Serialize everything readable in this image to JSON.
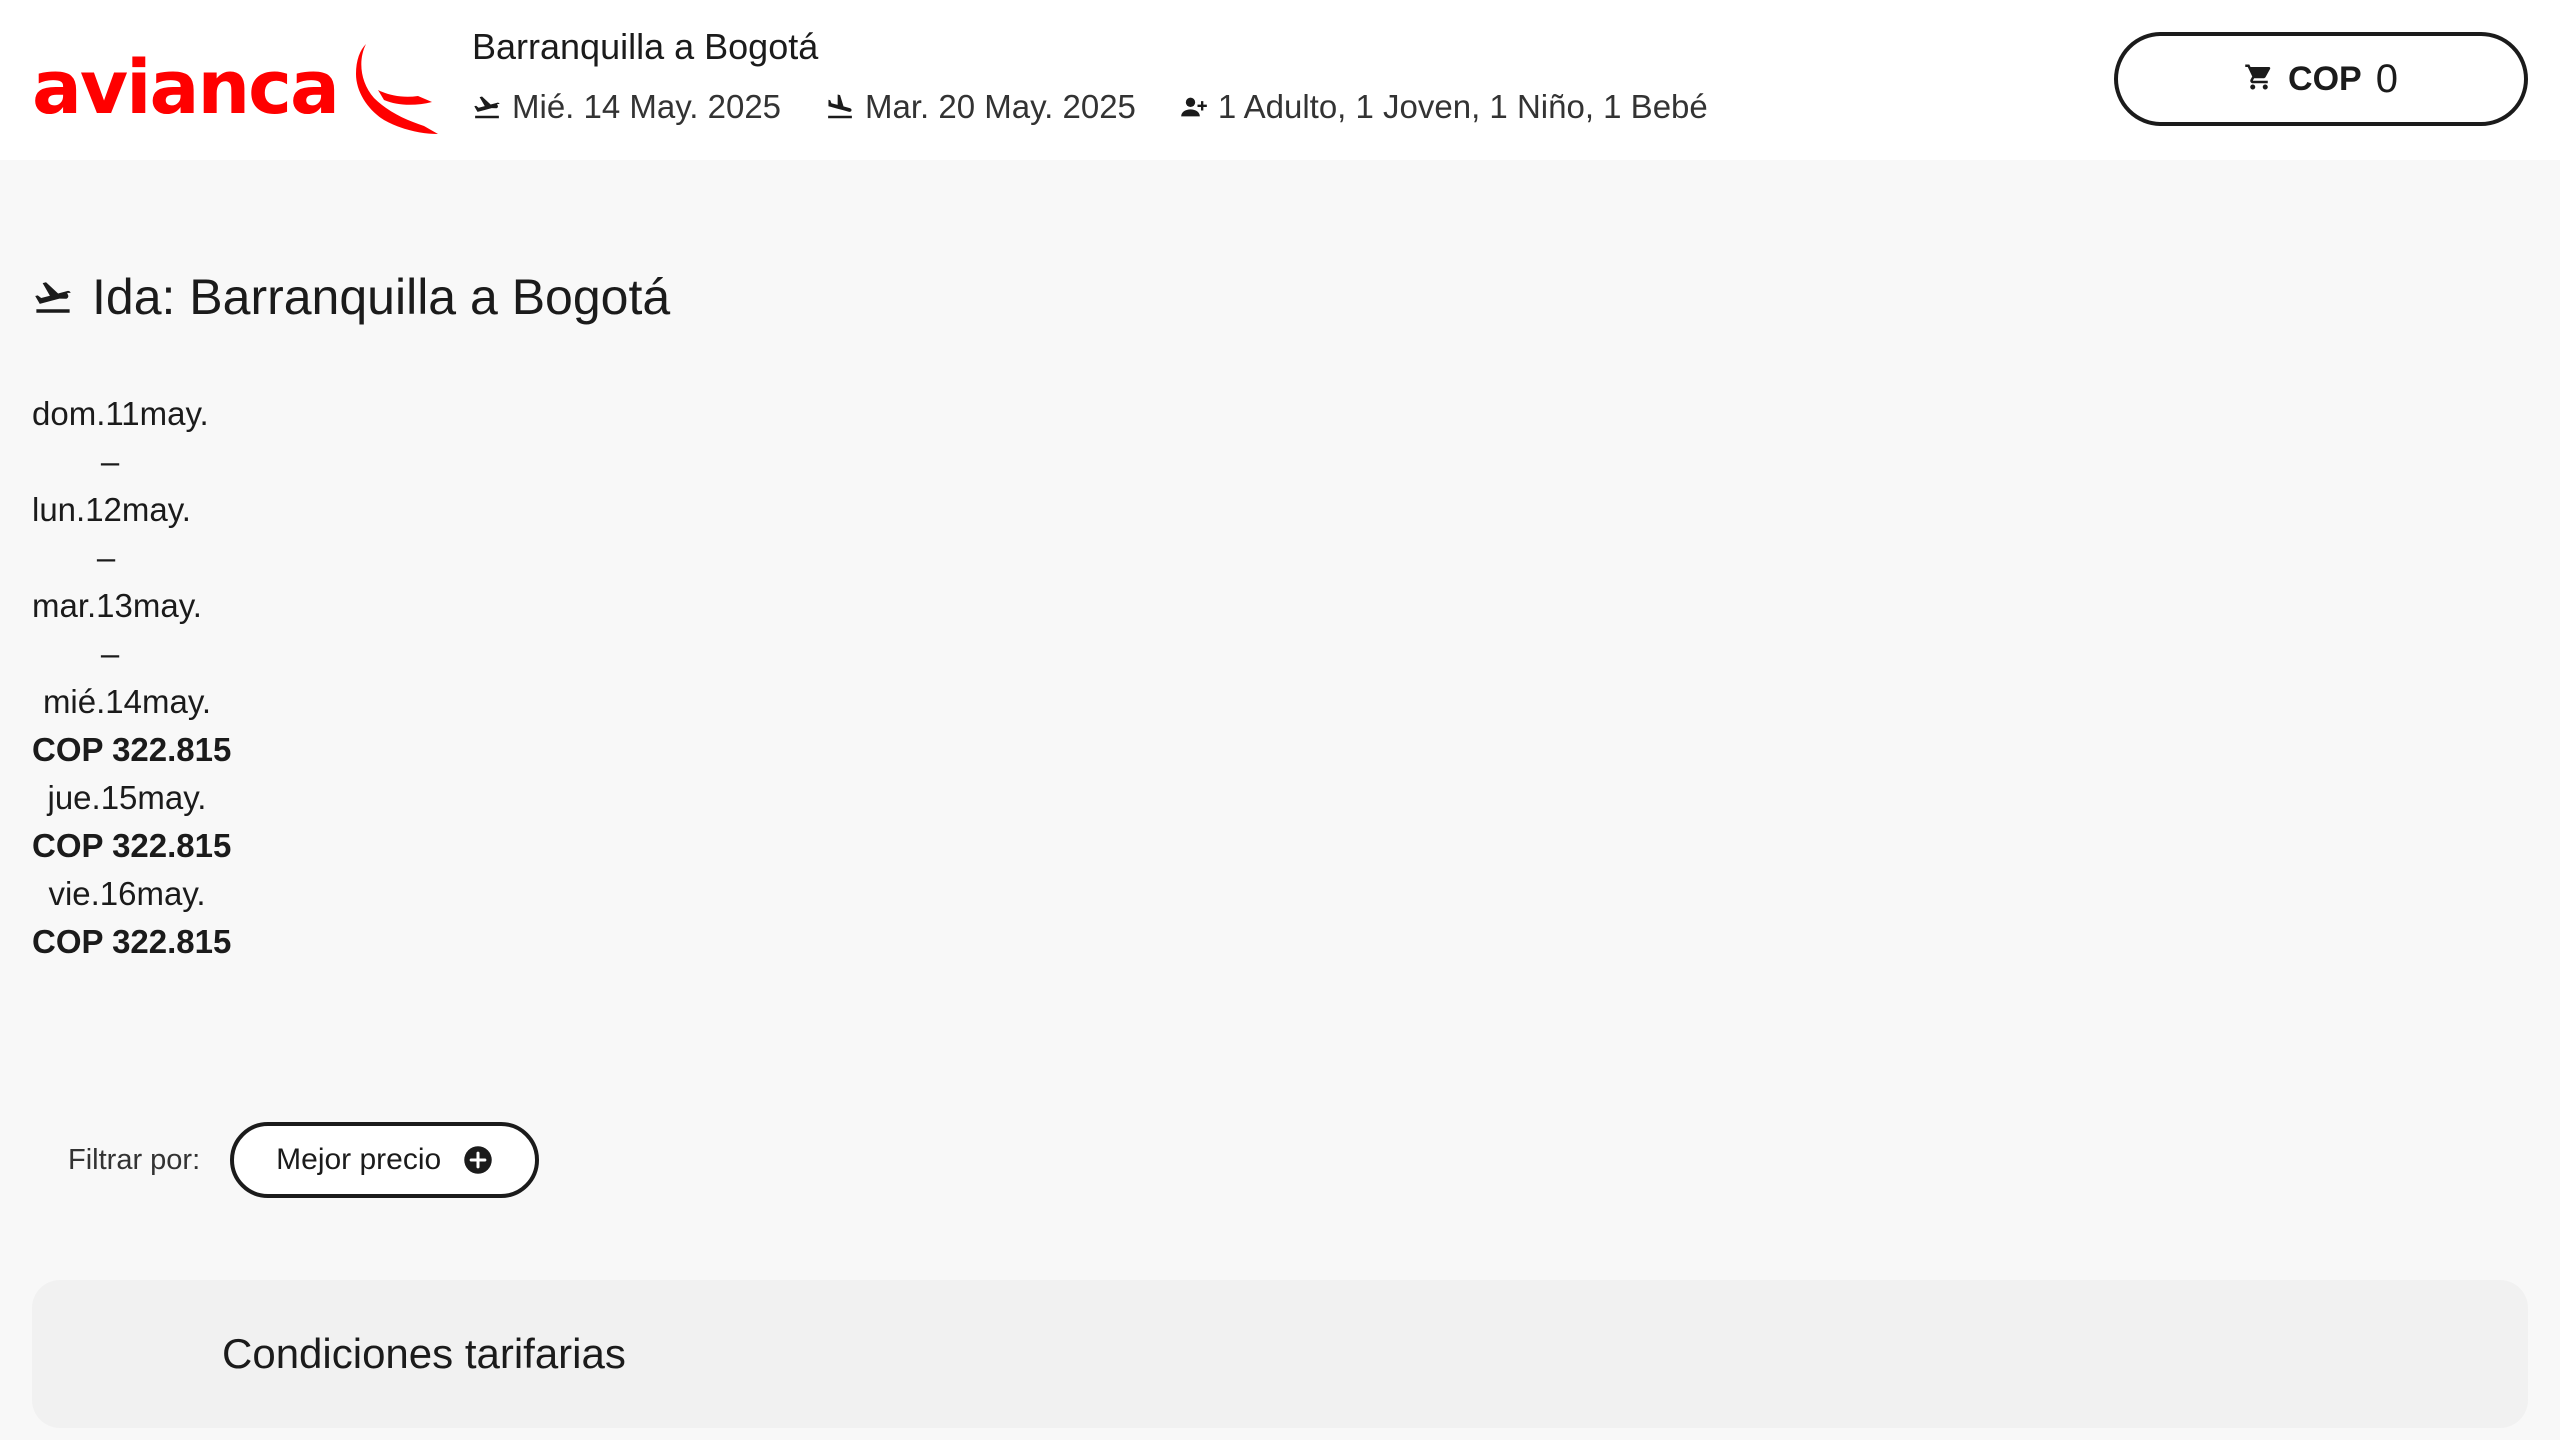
{
  "brand": {
    "logo_text": "avianca",
    "color": "#ff0000"
  },
  "header": {
    "route": "Barranquilla a Bogotá",
    "departure_date": "Mié. 14 May. 2025",
    "return_date": "Mar. 20 May. 2025",
    "passengers": "1 Adulto, 1 Joven, 1 Niño, 1 Bebé",
    "cart": {
      "currency": "COP",
      "amount": "0",
      "icon": "cart-icon"
    }
  },
  "outbound": {
    "title": "Ida: Barranquilla a Bogotá",
    "icon": "plane-takeoff-icon",
    "dates": [
      {
        "label": "dom.11may.",
        "price": "–"
      },
      {
        "label": "lun.12may.",
        "price": "–"
      },
      {
        "label": "mar.13may.",
        "price": "–"
      },
      {
        "label": "mié.14may.",
        "price": "COP 322.815"
      },
      {
        "label": "jue.15may.",
        "price": "COP 322.815"
      },
      {
        "label": "vie.16may.",
        "price": "COP 322.815"
      }
    ]
  },
  "filter": {
    "label": "Filtrar por:",
    "button_label": "Mejor precio",
    "button_icon": "plus-circle-icon"
  },
  "conditions": {
    "title": "Condiciones tarifarias"
  }
}
